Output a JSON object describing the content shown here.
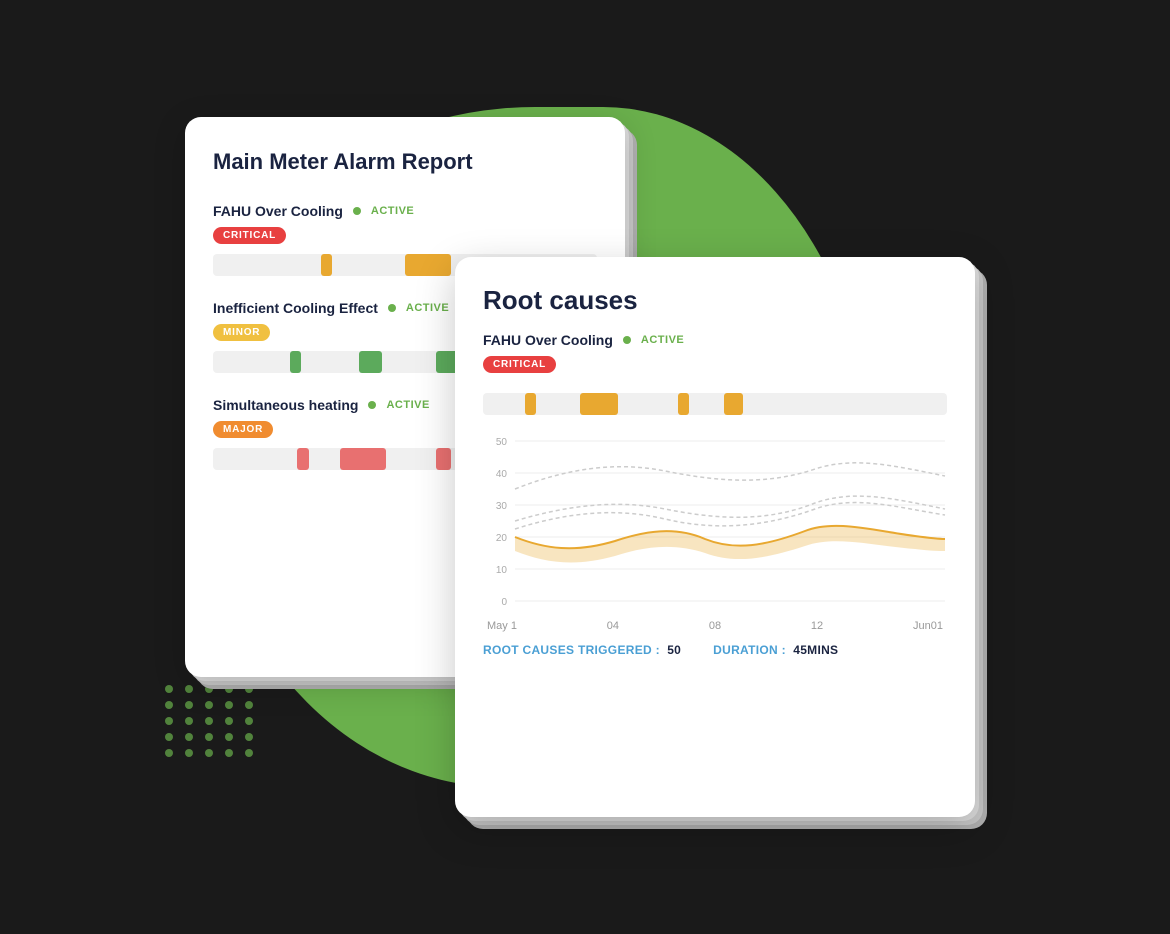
{
  "scene": {
    "background_color": "#1a1a1a"
  },
  "alarm_card": {
    "title": "Main Meter Alarm Report",
    "alarms": [
      {
        "name": "FAHU Over Cooling",
        "status": "ACTIVE",
        "badge": "CRITICAL",
        "badge_type": "critical",
        "bars": [
          {
            "left": "28%",
            "width": "3%",
            "color": "#e8a830"
          },
          {
            "left": "50%",
            "width": "12%",
            "color": "#e8a830"
          }
        ]
      },
      {
        "name": "Inefficient Cooling Effect",
        "status": "ACTIVE",
        "badge": "MINOR",
        "badge_type": "minor",
        "bars": [
          {
            "left": "20%",
            "width": "3%",
            "color": "#5caa5c"
          },
          {
            "left": "38%",
            "width": "6%",
            "color": "#5caa5c"
          },
          {
            "left": "58%",
            "width": "8%",
            "color": "#5caa5c"
          }
        ]
      },
      {
        "name": "Simultaneous heating",
        "status": "ACTIVE",
        "badge": "MAJOR",
        "badge_type": "major",
        "bars": [
          {
            "left": "22%",
            "width": "3%",
            "color": "#e87070"
          },
          {
            "left": "33%",
            "width": "12%",
            "color": "#e87070"
          },
          {
            "left": "58%",
            "width": "4%",
            "color": "#e87070"
          }
        ]
      }
    ]
  },
  "root_card": {
    "title": "Root causes",
    "alarm_name": "FAHU Over Cooling",
    "status": "ACTIVE",
    "badge": "CRITICAL",
    "badge_type": "critical",
    "timeline_bars": [
      {
        "left": "9%",
        "width": "2.5%",
        "color": "#e8a830"
      },
      {
        "left": "21%",
        "width": "8%",
        "color": "#e8a830"
      },
      {
        "left": "42%",
        "width": "2.5%",
        "color": "#e8a830"
      },
      {
        "left": "52%",
        "width": "4%",
        "color": "#e8a830"
      }
    ],
    "chart": {
      "y_labels": [
        "50",
        "40",
        "30",
        "20",
        "10",
        "0"
      ],
      "x_labels": [
        "May 1",
        "04",
        "08",
        "12",
        "Jun01"
      ]
    },
    "footer": {
      "root_causes_label": "ROOT CAUSES TRIGGERED :",
      "root_causes_value": "50",
      "duration_label": "DURATION :",
      "duration_value": "45MINS"
    }
  }
}
